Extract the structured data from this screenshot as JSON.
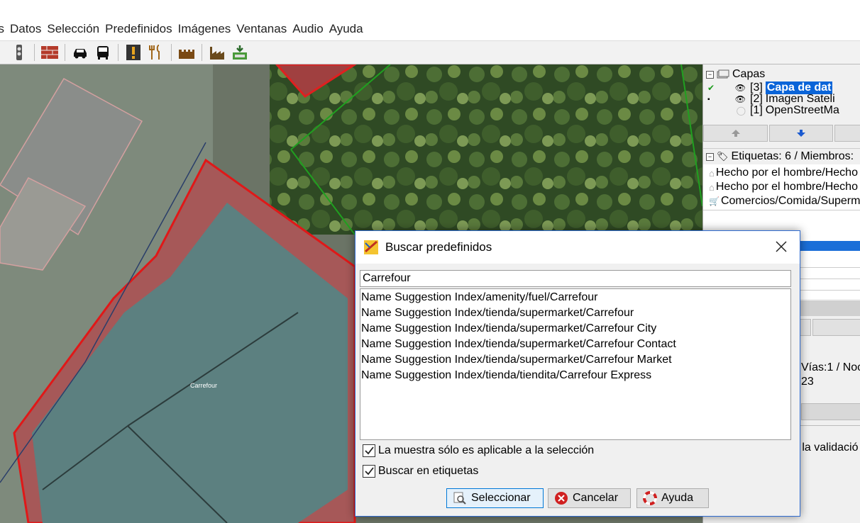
{
  "menu": [
    "as",
    "Datos",
    "Selección",
    "Predefinidos",
    "Imágenes",
    "Ventanas",
    "Audio",
    "Ayuda"
  ],
  "toolbar_icons": [
    "traffic-light-icon",
    "brick-wall-icon",
    "car-icon",
    "bus-icon",
    "warning-icon",
    "restaurant-icon",
    "castle-icon",
    "factory-icon",
    "shop-icon"
  ],
  "map": {
    "label": "Carrefour"
  },
  "layers_panel": {
    "title": "Capas",
    "layers": [
      {
        "num": "[3]",
        "name": "Capa de dat",
        "active": true
      },
      {
        "num": "[2]",
        "name": "Imagen Sateli",
        "active": false
      },
      {
        "num": "[1]",
        "name": "OpenStreetMa",
        "active": false
      }
    ]
  },
  "tags_panel": {
    "title": "Etiquetas: 6 / Miembros:",
    "rows": [
      "Hecho por el hombre/Hecho",
      "Hecho por el hombre/Hecho",
      "Comercios/Comida/Superm"
    ]
  },
  "side_misc": {
    "ways": "Vías:1 / Noc",
    "value": "23",
    "validation": "e la validació"
  },
  "dialog": {
    "title": "Buscar predefinidos",
    "search_value": "Carrefour",
    "results": [
      "Name Suggestion Index/amenity/fuel/Carrefour",
      "Name Suggestion Index/tienda/supermarket/Carrefour",
      "Name Suggestion Index/tienda/supermarket/Carrefour City",
      "Name Suggestion Index/tienda/supermarket/Carrefour Contact",
      "Name Suggestion Index/tienda/supermarket/Carrefour Market",
      "Name Suggestion Index/tienda/tiendita/Carrefour Express"
    ],
    "checkbox1": "La muestra sólo es aplicable a la selección",
    "checkbox2": "Buscar en etiquetas",
    "btn_select": "Seleccionar",
    "btn_cancel": "Cancelar",
    "btn_help": "Ayuda"
  }
}
